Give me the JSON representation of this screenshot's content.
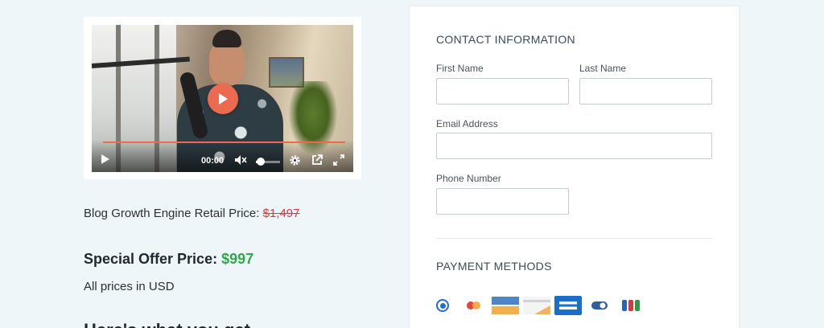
{
  "video": {
    "time": "00:00",
    "progress": 0,
    "volume": 0.2,
    "accent_color": "#ec6a4f"
  },
  "pricing": {
    "retail_label": "Blog Growth Engine Retail Price: ",
    "retail_price": "$1,497",
    "special_label": "Special Offer Price: ",
    "special_price": "$997",
    "currency_note": "All prices in USD",
    "next_heading": "Here's what you get"
  },
  "contact": {
    "title": "CONTACT INFORMATION",
    "first_name": {
      "label": "First Name",
      "value": ""
    },
    "last_name": {
      "label": "Last Name",
      "value": ""
    },
    "email": {
      "label": "Email Address",
      "value": ""
    },
    "phone": {
      "label": "Phone Number",
      "value": ""
    }
  },
  "payment": {
    "title": "PAYMENT METHODS",
    "selected_index": 0,
    "icons": [
      "mastercard-icon",
      "card-blue-orange-icon",
      "card-grey-orange-icon",
      "amex-icon",
      "toggle-card-icon",
      "jcb-icon"
    ]
  },
  "colors": {
    "background": "#eef6fa",
    "price_green": "#2ea84a",
    "strike_red": "#d93b3b",
    "radio_blue": "#1f6fd1"
  }
}
